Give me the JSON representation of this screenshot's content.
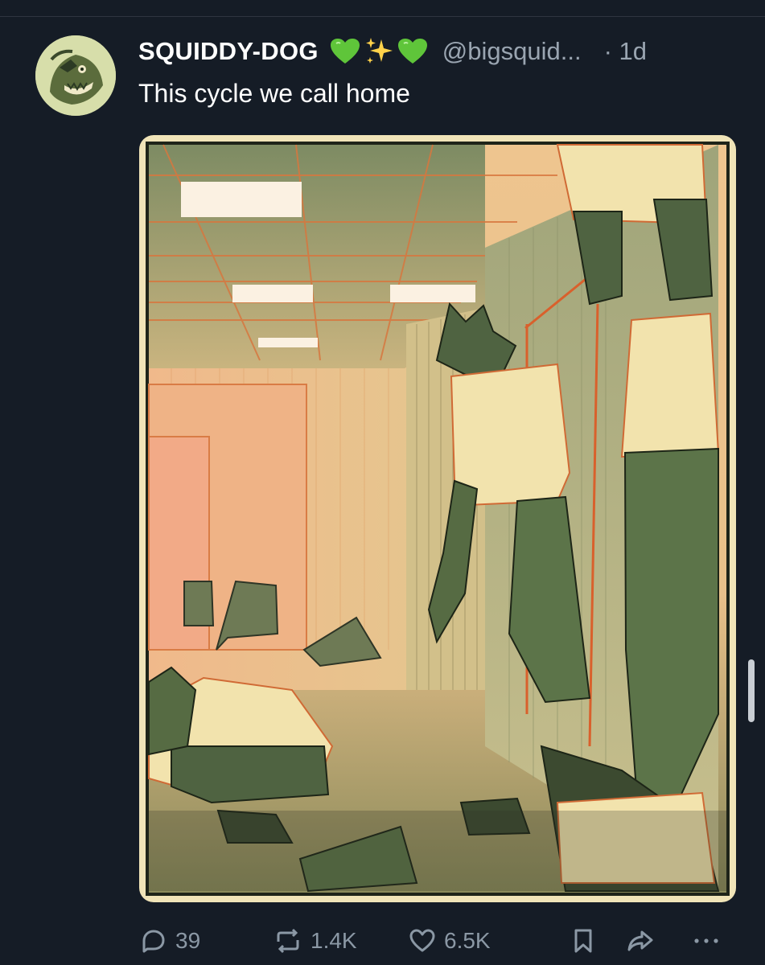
{
  "post": {
    "display_name": "SQUIDDY-DOG",
    "name_emojis": [
      "💚",
      "✨",
      "💚"
    ],
    "handle": "@bigsquid...",
    "time": "· 1d",
    "text": "This cycle we call home"
  },
  "actions": {
    "replies": "39",
    "reposts": "1.4K",
    "likes": "6.5K"
  },
  "icons": {
    "reply": "speech-bubble-icon",
    "repost": "repost-arrows-icon",
    "like": "heart-icon",
    "bookmark": "bookmark-icon",
    "share": "share-arrow-icon",
    "more": "more-dots-icon"
  },
  "colors": {
    "background": "#151c26",
    "text": "#ffffff",
    "muted": "#9aa5b1",
    "heart_green": "#5fc53a"
  }
}
